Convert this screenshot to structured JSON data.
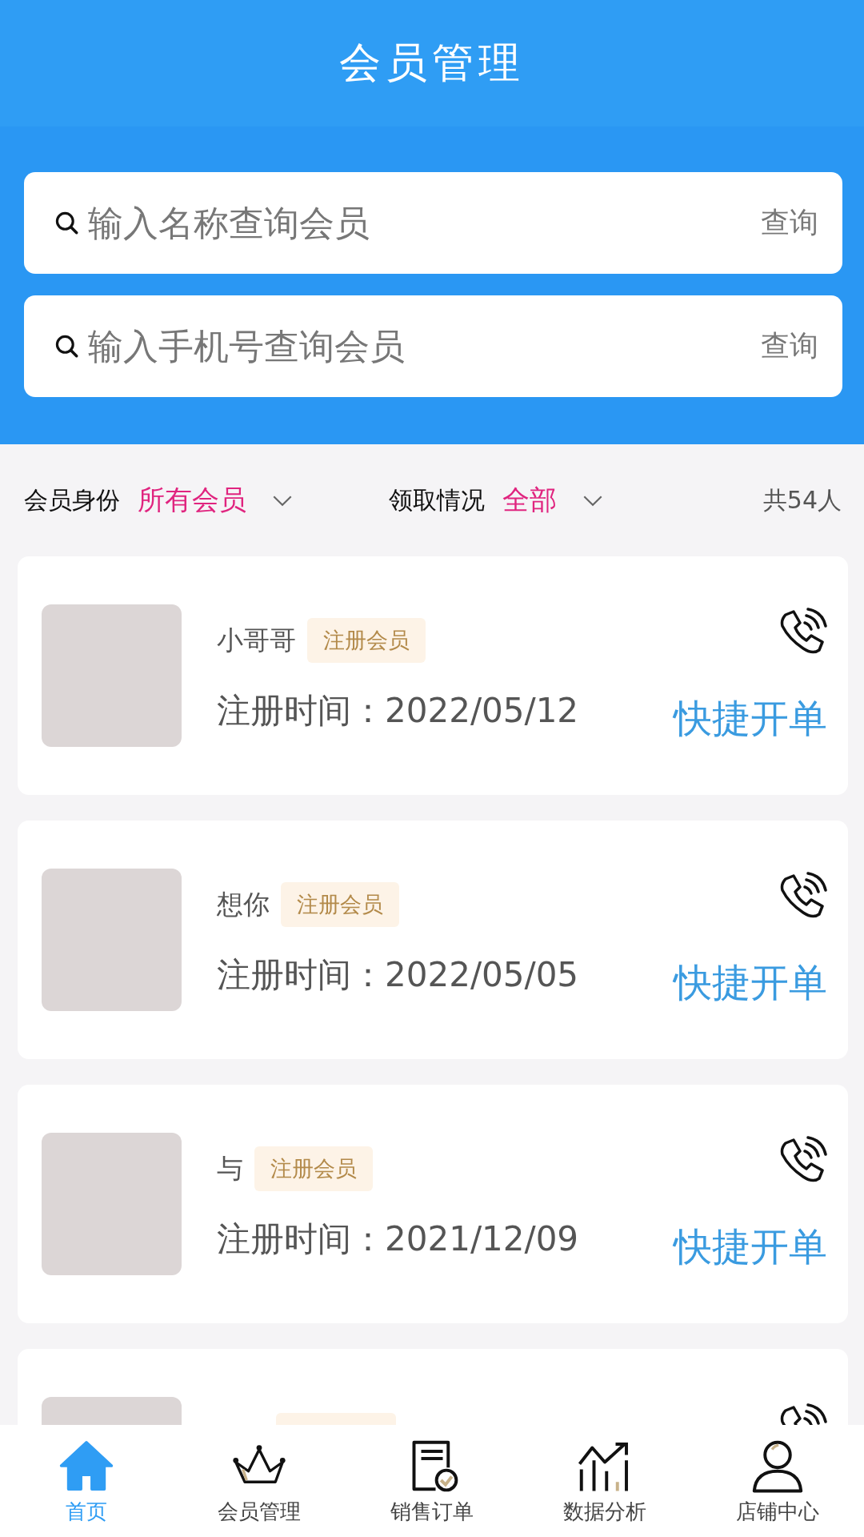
{
  "header": {
    "title": "会员管理"
  },
  "searches": [
    {
      "placeholder": "输入名称查询会员",
      "button": "查询"
    },
    {
      "placeholder": "输入手机号查询会员",
      "button": "查询"
    }
  ],
  "filters": [
    {
      "label": "会员身份",
      "value": "所有会员"
    },
    {
      "label": "领取情况",
      "value": "全部"
    }
  ],
  "total": "共54人",
  "members": [
    {
      "name": "小哥哥",
      "tag": "注册会员",
      "registered": "注册时间：2022/05/12",
      "action": "快捷开单"
    },
    {
      "name": "想你",
      "tag": "注册会员",
      "registered": "注册时间：2022/05/05",
      "action": "快捷开单"
    },
    {
      "name": "与",
      "tag": "注册会员",
      "registered": "注册时间：2021/12/09",
      "action": "快捷开单"
    },
    {
      "kind": "cut"
    }
  ],
  "nav": [
    {
      "kind": "home",
      "label": "首页",
      "selected": true
    },
    {
      "kind": "crown",
      "label": "会员管理",
      "selected": false
    },
    {
      "kind": "order",
      "label": "销售订单",
      "selected": false
    },
    {
      "kind": "chart",
      "label": "数据分析",
      "selected": false
    },
    {
      "kind": "user",
      "label": "店铺中心",
      "selected": false
    }
  ]
}
